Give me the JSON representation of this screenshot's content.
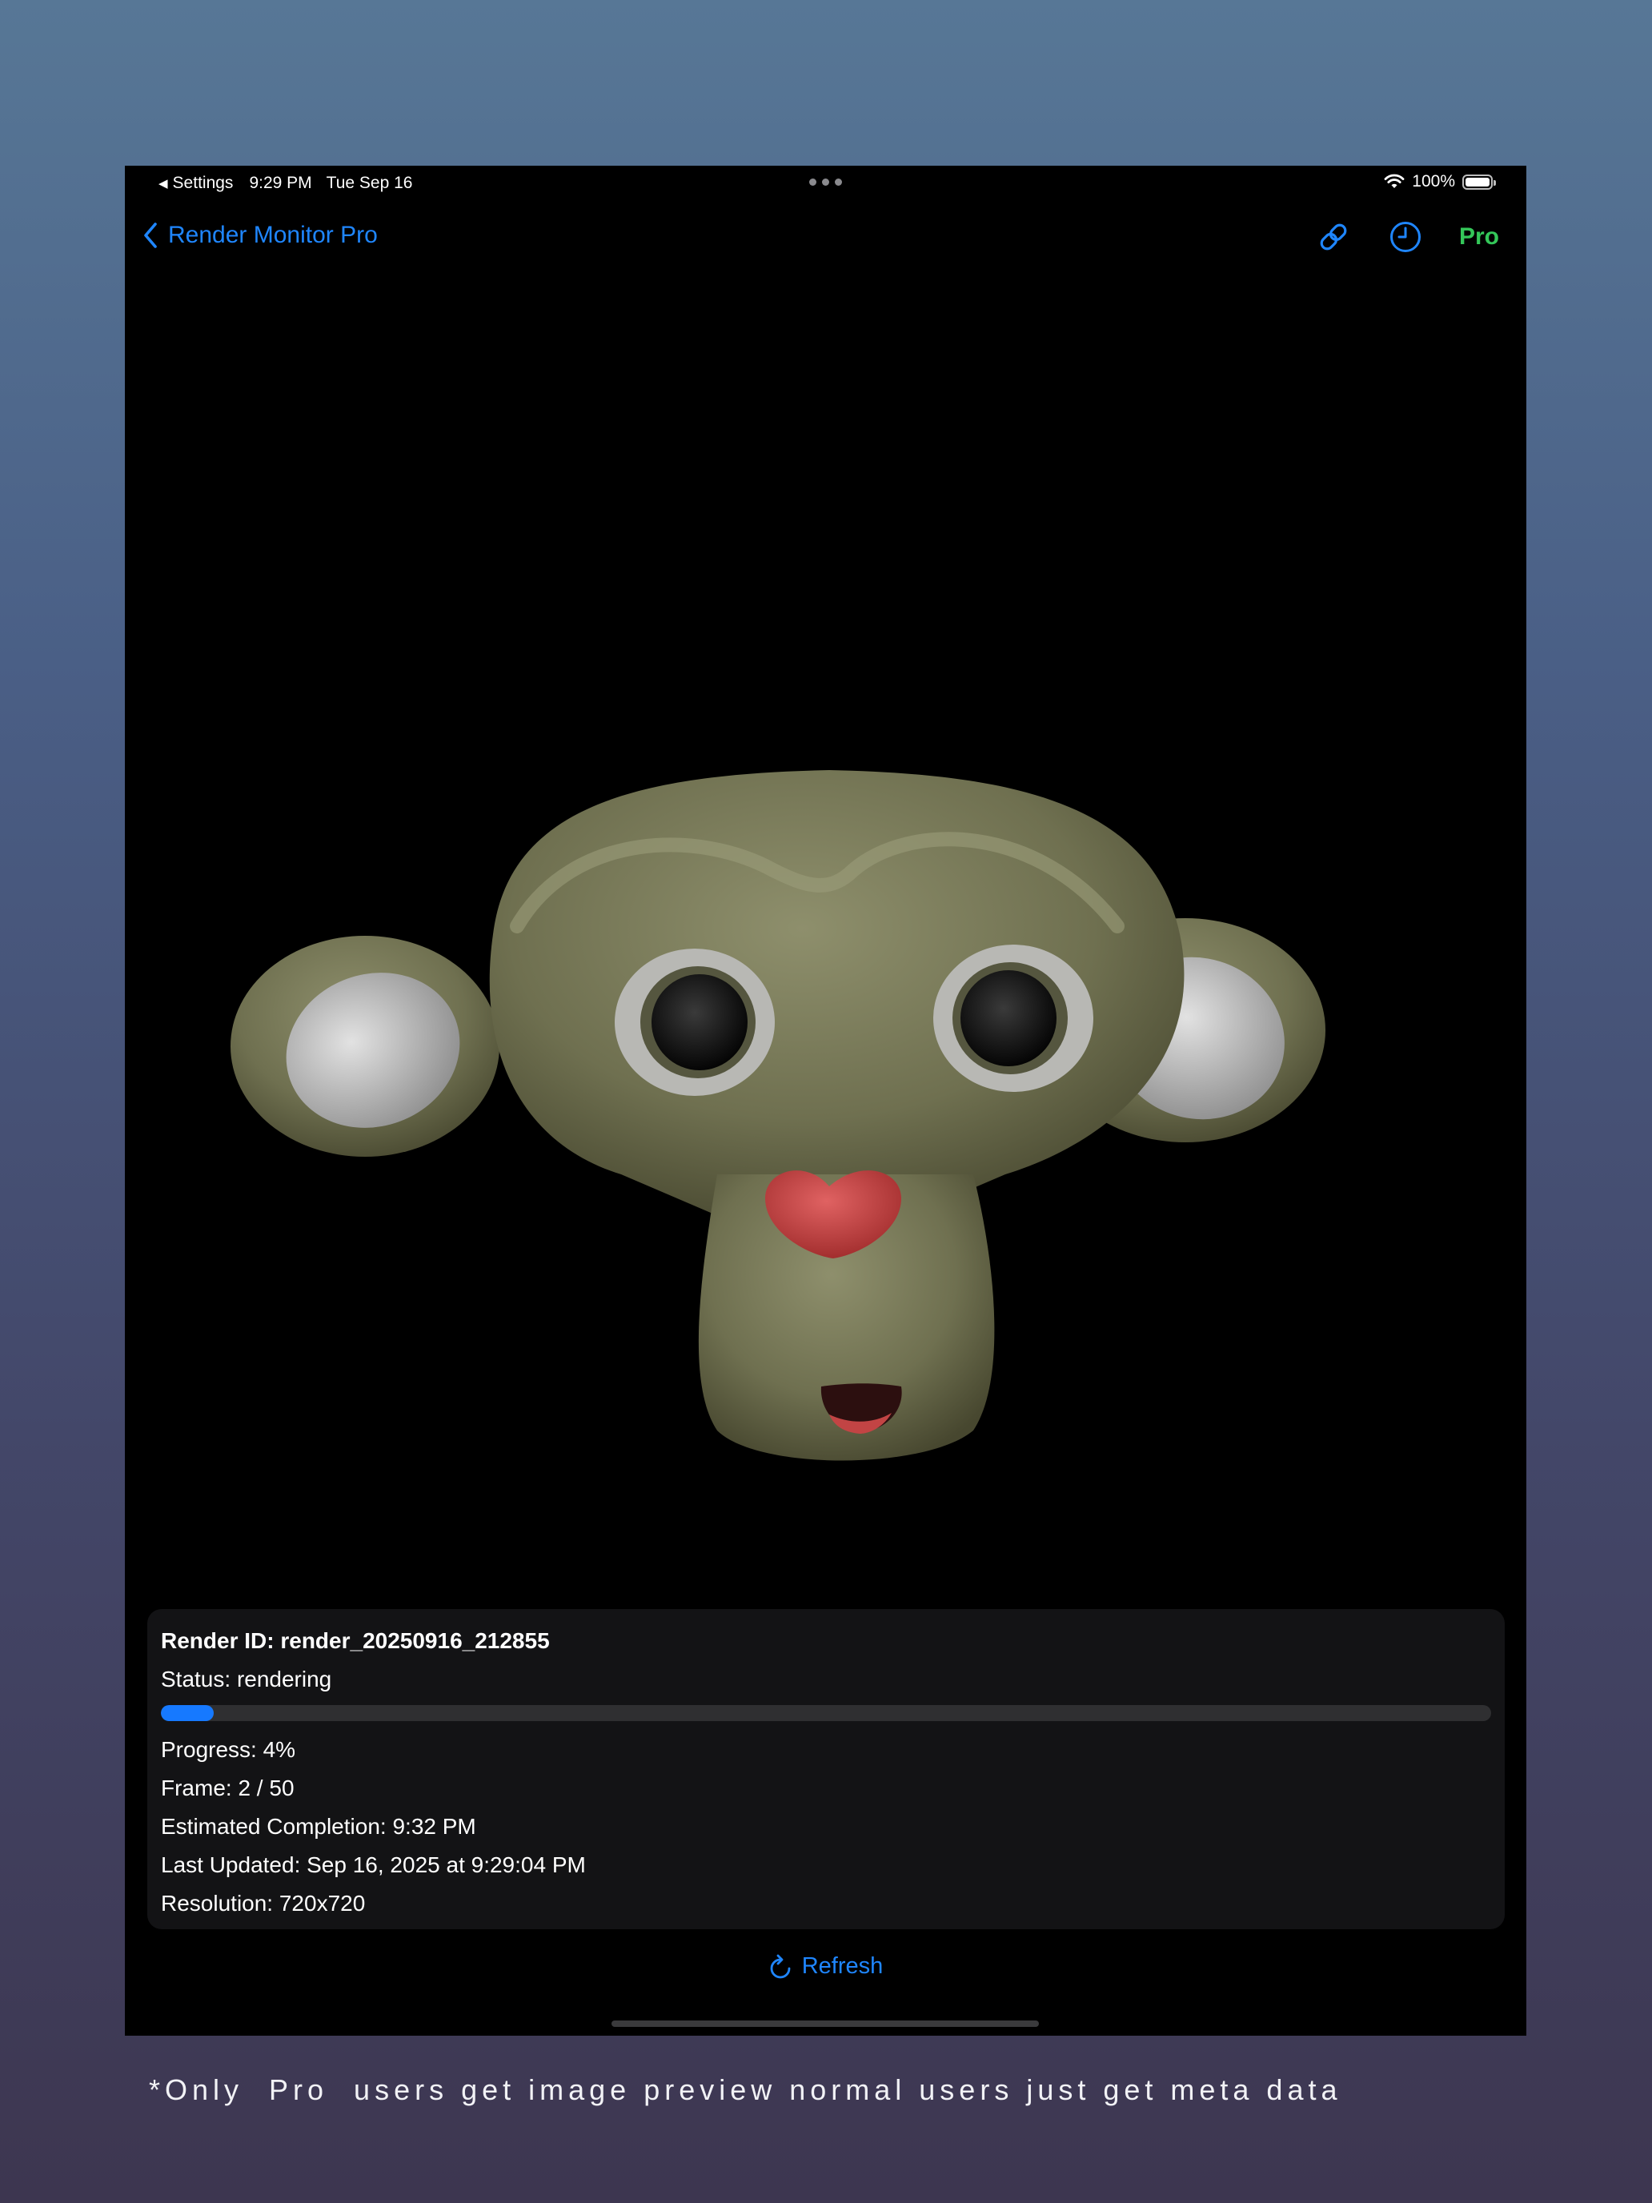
{
  "status_bar": {
    "back_label": "Settings",
    "time": "9:29 PM",
    "date": "Tue Sep 16",
    "battery": "100%"
  },
  "nav": {
    "back_label": "Render Monitor Pro",
    "pro_label": "Pro"
  },
  "render": {
    "render_id": "Render ID: render_20250916_212855",
    "status": "Status: rendering",
    "progress_text": "Progress: 4%",
    "progress_value": 0.04,
    "frame": "Frame: 2 / 50",
    "estimated_completion": "Estimated Completion: 9:32 PM",
    "last_updated": "Last Updated: Sep 16, 2025 at 9:29:04 PM",
    "resolution": "Resolution: 720x720"
  },
  "actions": {
    "refresh_label": "Refresh"
  },
  "caption": "*Only  Pro  users get image preview normal users just get meta data",
  "colors": {
    "accent": "#1f86ff",
    "pro": "#34c759",
    "progress": "#1679ff",
    "card": "#131315"
  }
}
